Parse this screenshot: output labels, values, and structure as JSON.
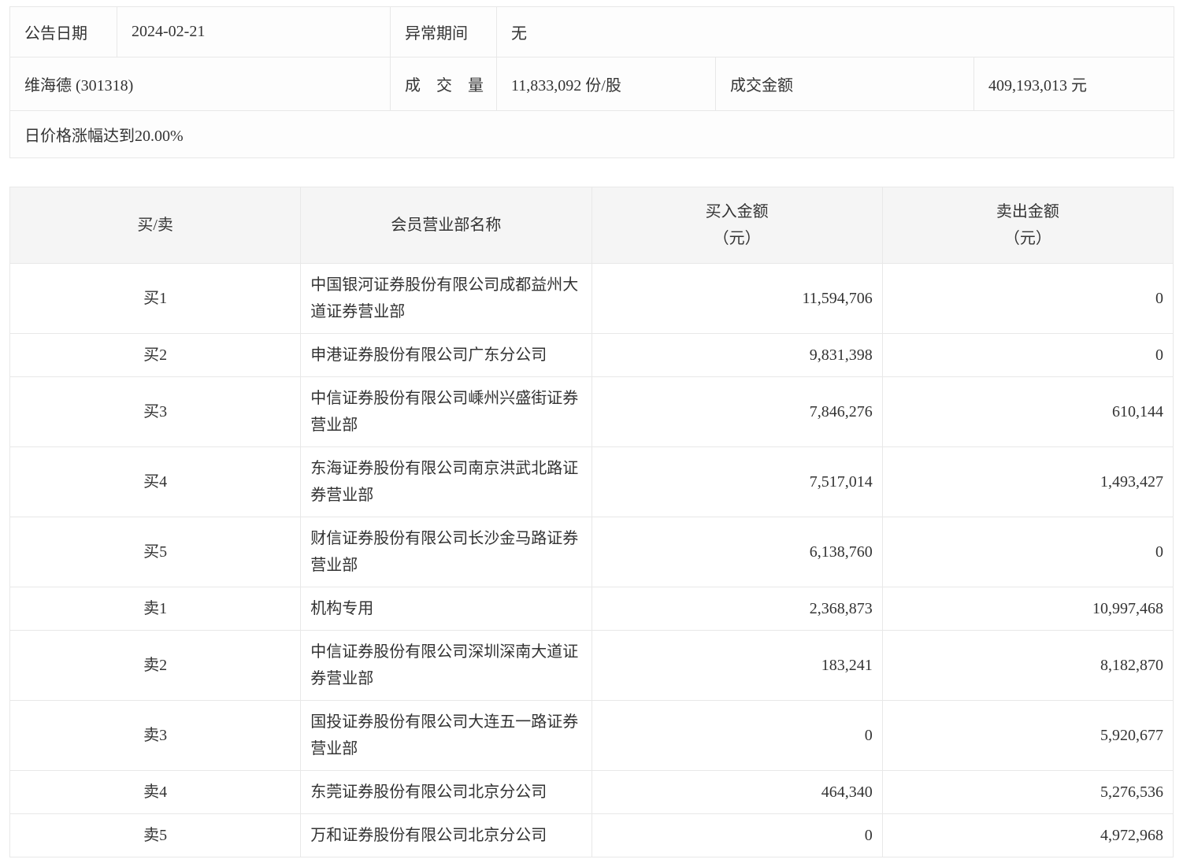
{
  "colors": {
    "header_bg": "#f5f5f5",
    "border": "#e8e8e8",
    "text": "#333333",
    "page_bg": "#ffffff"
  },
  "info": {
    "announce_date_label": "公告日期",
    "announce_date": "2024-02-21",
    "abnormal_period_label": "异常期间",
    "abnormal_period": "无",
    "security": "维海德 (301318)",
    "volume_label": "成　交　量",
    "volume": "11,833,092 份/股",
    "turnover_label": "成交金额",
    "turnover": "409,193,013 元",
    "reason": "日价格涨幅达到20.00%"
  },
  "table": {
    "headers": {
      "side": "买/卖",
      "branch": "会员营业部名称",
      "buy_line1": "买入金额",
      "buy_line2": "（元）",
      "sell_line1": "卖出金额",
      "sell_line2": "（元）"
    },
    "rows": [
      {
        "side": "买1",
        "branch": "中国银河证券股份有限公司成都益州大道证券营业部",
        "buy": "11,594,706",
        "sell": "0"
      },
      {
        "side": "买2",
        "branch": "申港证券股份有限公司广东分公司",
        "buy": "9,831,398",
        "sell": "0"
      },
      {
        "side": "买3",
        "branch": "中信证券股份有限公司嵊州兴盛街证券营业部",
        "buy": "7,846,276",
        "sell": "610,144"
      },
      {
        "side": "买4",
        "branch": "东海证券股份有限公司南京洪武北路证券营业部",
        "buy": "7,517,014",
        "sell": "1,493,427"
      },
      {
        "side": "买5",
        "branch": "财信证券股份有限公司长沙金马路证券营业部",
        "buy": "6,138,760",
        "sell": "0"
      },
      {
        "side": "卖1",
        "branch": "机构专用",
        "buy": "2,368,873",
        "sell": "10,997,468"
      },
      {
        "side": "卖2",
        "branch": "中信证券股份有限公司深圳深南大道证券营业部",
        "buy": "183,241",
        "sell": "8,182,870"
      },
      {
        "side": "卖3",
        "branch": "国投证券股份有限公司大连五一路证券营业部",
        "buy": "0",
        "sell": "5,920,677"
      },
      {
        "side": "卖4",
        "branch": "东莞证券股份有限公司北京分公司",
        "buy": "464,340",
        "sell": "5,276,536"
      },
      {
        "side": "卖5",
        "branch": "万和证券股份有限公司北京分公司",
        "buy": "0",
        "sell": "4,972,968"
      }
    ]
  }
}
